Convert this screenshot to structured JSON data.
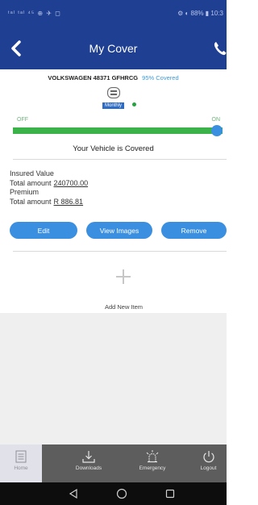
{
  "status_bar": {
    "left": "ᵗᵃˡ ᵗᵃˡ ⁴⁵ ⊕ ✈ ◻",
    "right": "⚙ ◐ 88% ▮ 10:3"
  },
  "header": {
    "title": "My Cover"
  },
  "vehicle": {
    "name": "VOLKSWAGEN 48371 GFHRCG",
    "coverage": "95% Covered",
    "frequency": "Monthly"
  },
  "toggle": {
    "off_label": "OFF",
    "on_label": "ON",
    "state": "on"
  },
  "status_message": "Your Vehicle is Covered",
  "insured": {
    "section_label": "Insured Value",
    "total_label": "Total amount",
    "total_value": "240700.00"
  },
  "premium": {
    "section_label": "Premium",
    "total_label": "Total amount",
    "total_value": "R 886.81"
  },
  "actions": {
    "edit": "Edit",
    "view_images": "View Images",
    "remove": "Remove"
  },
  "add_item": {
    "label": "Add New Item"
  },
  "tabbar": {
    "home": "Home",
    "downloads": "Downloads",
    "emergency": "Emergency",
    "logout": "Logout"
  },
  "colors": {
    "header_bg": "#1f3f93",
    "accent_blue": "#3b8fe0",
    "toggle_green": "#3cb34a",
    "tabbar_bg": "#5d5d5d"
  },
  "icons": {
    "back": "chevron-left-icon",
    "phone": "phone-icon",
    "car": "car-icon",
    "add": "plus-icon",
    "home": "home-icon",
    "downloads": "download-icon",
    "emergency": "siren-icon",
    "logout": "power-icon"
  }
}
